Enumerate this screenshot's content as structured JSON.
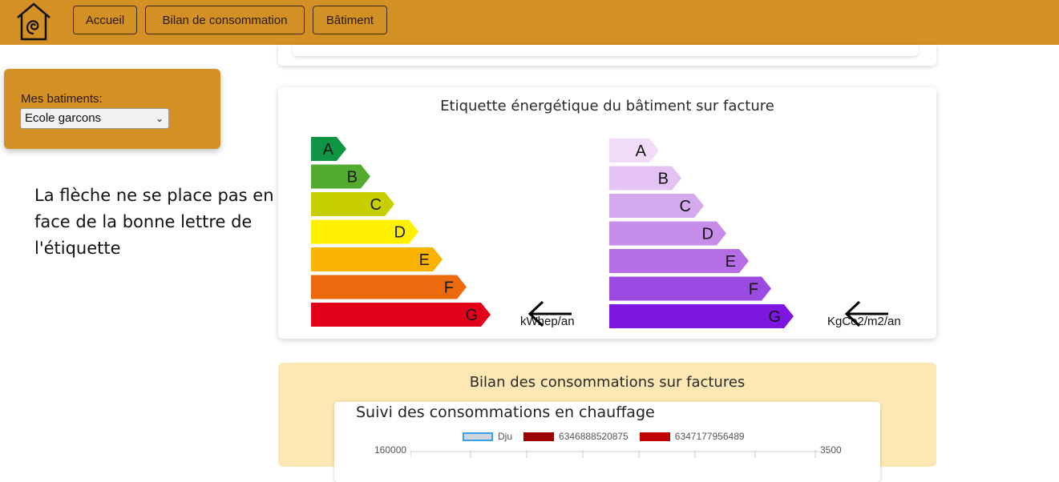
{
  "nav": {
    "buttons": [
      {
        "label": "Accueil"
      },
      {
        "label": "Bilan de consommation"
      },
      {
        "label": "Bâtiment"
      }
    ]
  },
  "sidebar": {
    "label": "Mes batiments:",
    "selected": "Ecole garcons"
  },
  "annotation": "La flèche ne se place pas en face de la bonne lettre de l'étiquette",
  "energy_card": {
    "title": "Etiquette énergétique du bâtiment sur facture",
    "energy_scale": {
      "letters": [
        "A",
        "B",
        "C",
        "D",
        "E",
        "F",
        "G"
      ],
      "colors": [
        "#0e9443",
        "#52ab2e",
        "#c6cf00",
        "#fff000",
        "#fab300",
        "#eb6a0e",
        "#e2001a"
      ],
      "unit": "kWhep/an"
    },
    "ges_scale": {
      "letters": [
        "A",
        "B",
        "C",
        "D",
        "E",
        "F",
        "G"
      ],
      "colors": [
        "#f0dcf7",
        "#e2c3f3",
        "#d5a9ee",
        "#c78dea",
        "#b56ee5",
        "#9a4ae0",
        "#7d17e0"
      ],
      "unit": "KgCo2/m2/an"
    }
  },
  "bilan_card": {
    "title": "Bilan des consommations sur factures",
    "chart": {
      "title": "Suivi des consommations en chauffage",
      "legend": [
        {
          "name": "Dju",
          "color": "#d0d6e0",
          "border": "#3aa0e8"
        },
        {
          "name": "6346888520875",
          "color": "#9c0000"
        },
        {
          "name": "6347177956489",
          "color": "#c00000"
        }
      ],
      "y_left_max": "160000",
      "y_right_max": "3500"
    }
  }
}
